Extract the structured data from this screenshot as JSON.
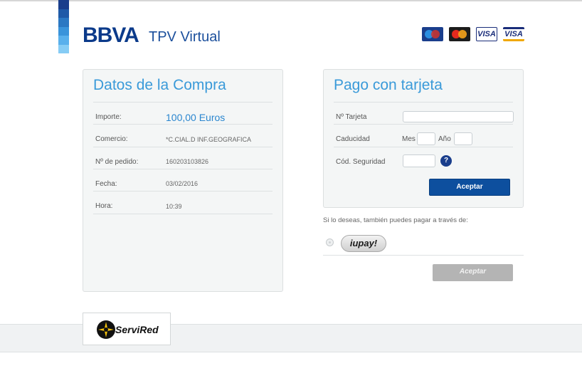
{
  "header": {
    "brand": "BBVA",
    "product": "TPV Virtual",
    "cards": [
      "Maestro",
      "MasterCard",
      "VISA",
      "VISA"
    ],
    "stripe_colors": [
      "#1a3e8c",
      "#1f5aa8",
      "#2b78c3",
      "#3a94db",
      "#59b0ec",
      "#86ccf5"
    ]
  },
  "purchase": {
    "title": "Datos de la Compra",
    "rows": [
      {
        "label": "Importe:",
        "value": "100,00 Euros"
      },
      {
        "label": "Comercio:",
        "value": "*C.CIAL.D INF.GEOGRAFICA"
      },
      {
        "label": "Nº de pedido:",
        "value": "160203103826"
      },
      {
        "label": "Fecha:",
        "value": "03/02/2016"
      },
      {
        "label": "Hora:",
        "value": "10:39"
      }
    ]
  },
  "payment": {
    "title": "Pago con tarjeta",
    "card_label": "Nº Tarjeta",
    "card_value": "",
    "expiry_label": "Caducidad",
    "month_label": "Mes",
    "year_label": "Año",
    "cvv_label": "Cód. Seguridad",
    "help_symbol": "?",
    "submit": "Aceptar"
  },
  "alternative": {
    "text": "Si lo deseas, también puedes pagar a través de:",
    "iupay_label": "iupay!",
    "submit": "Aceptar"
  },
  "footer": {
    "servired_label": "ServiRed"
  }
}
